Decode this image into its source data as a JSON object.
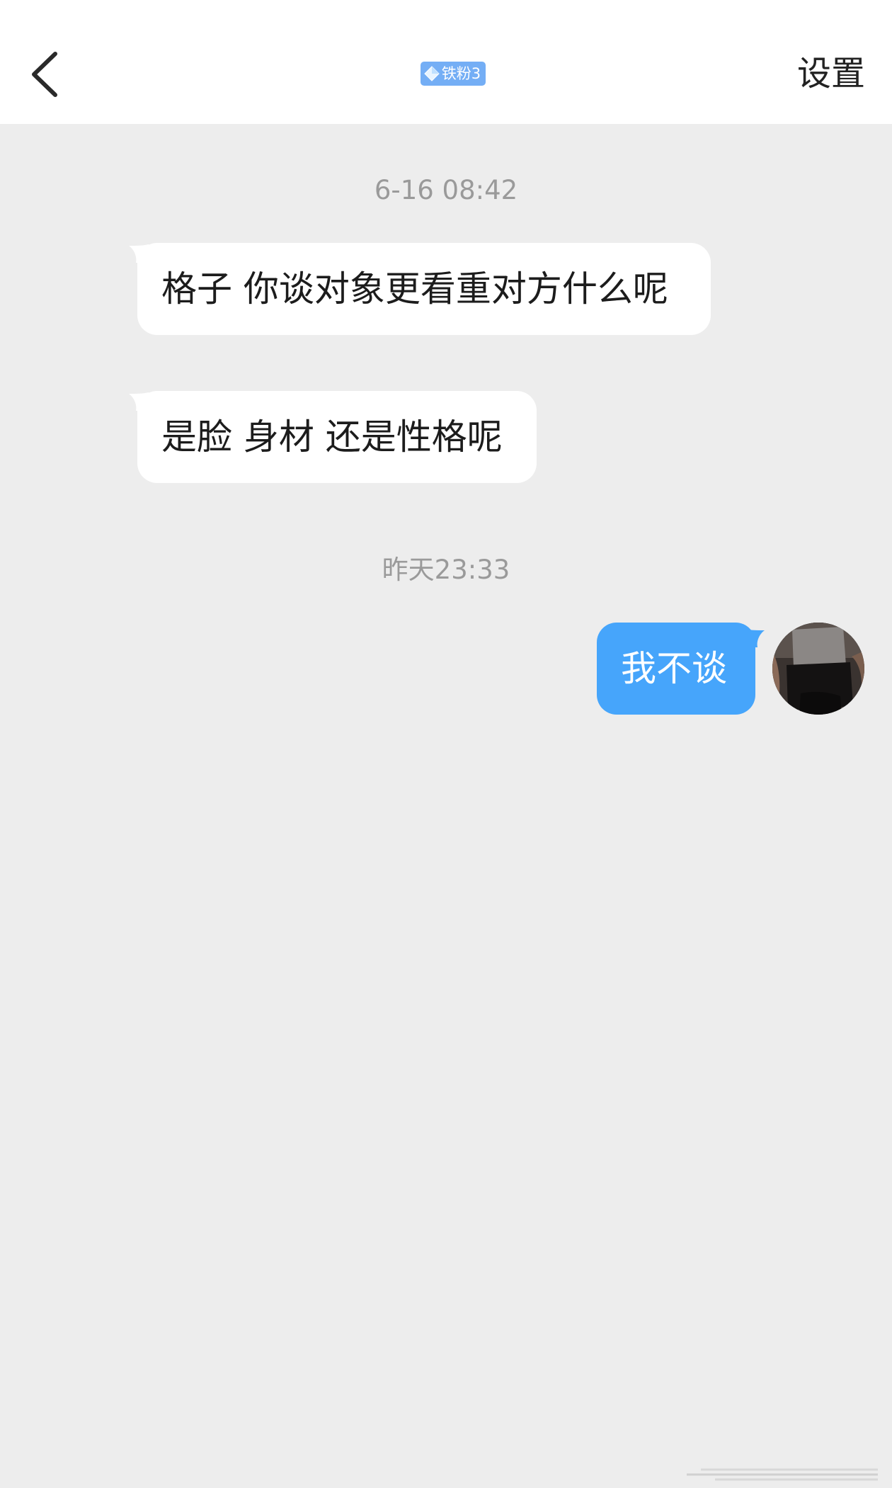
{
  "header": {
    "contact_name": "",
    "badge_label": "铁粉3",
    "settings_label": "设置"
  },
  "messages": [
    {
      "timestamp": "6-16 08:42"
    },
    {
      "sender": "other",
      "text": "格子 你谈对象更看重对方什么呢"
    },
    {
      "sender": "other",
      "text": "是脸 身材 还是性格呢"
    },
    {
      "timestamp": "昨天23:33"
    },
    {
      "sender": "me",
      "text": "我不谈"
    }
  ],
  "colors": {
    "background": "#ededed",
    "header_background": "#ffffff",
    "incoming_bubble": "#ffffff",
    "outgoing_bubble": "#46a5fb",
    "badge": "#74aef5",
    "timestamp_text": "#9a9a9a"
  },
  "icons": {
    "back": "chevron-left-icon",
    "badge": "diamond-icon",
    "avatar": "user-avatar"
  }
}
